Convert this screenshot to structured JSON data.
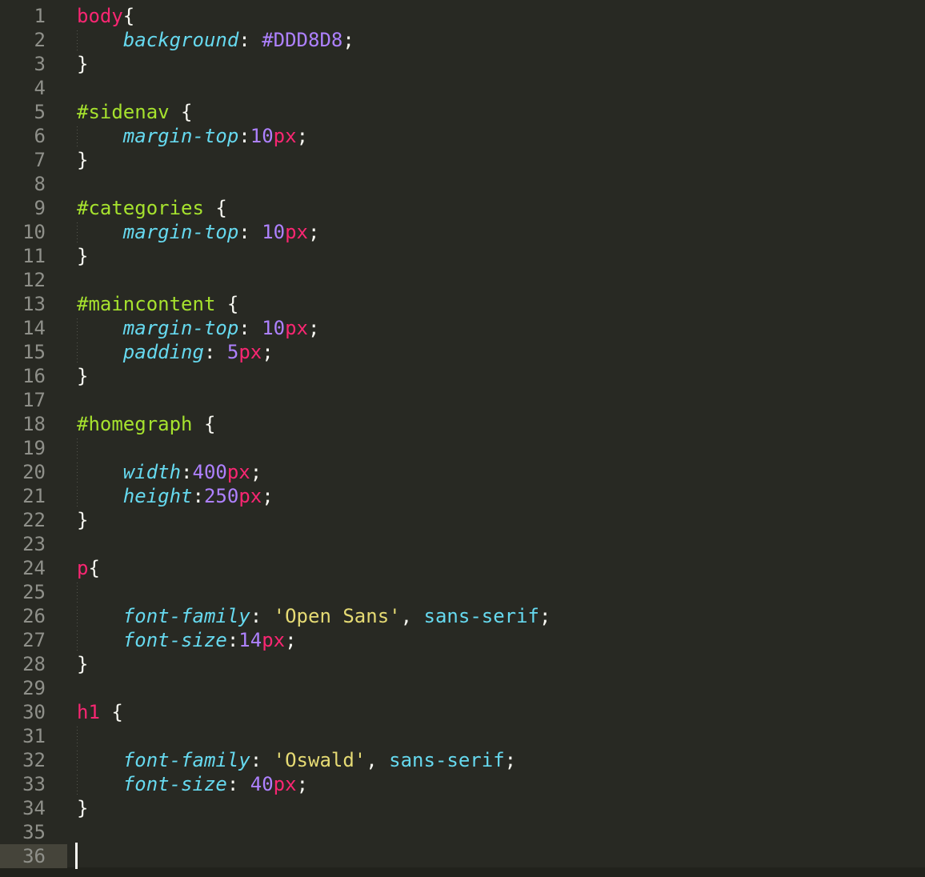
{
  "theme": {
    "bg": "#282923",
    "fg": "#f8f8f2",
    "pink": "#f92672",
    "green": "#a6e22e",
    "cyan": "#66d9ef",
    "purple": "#ae81ff",
    "yellow": "#e6db74",
    "gutter-text": "#8f908a",
    "active-line": "#45443a",
    "guide": "#55564e",
    "caret": "#f8f8f2",
    "bottom": "#21221c"
  },
  "editor": {
    "language": "css",
    "active_line_number": 36,
    "lines": [
      {
        "n": 1,
        "tokens": [
          [
            "sel",
            "body"
          ],
          [
            "punct",
            "{"
          ]
        ]
      },
      {
        "n": 2,
        "guide": true,
        "tokens": [
          [
            "ws",
            "    "
          ],
          [
            "prop",
            "background"
          ],
          [
            "punct",
            ": "
          ],
          [
            "val",
            "#DDD8D8"
          ],
          [
            "punct",
            ";"
          ]
        ]
      },
      {
        "n": 3,
        "tokens": [
          [
            "punct",
            "}"
          ]
        ]
      },
      {
        "n": 4,
        "tokens": []
      },
      {
        "n": 5,
        "tokens": [
          [
            "id",
            "#sidenav"
          ],
          [
            "punct",
            " {"
          ]
        ]
      },
      {
        "n": 6,
        "guide": true,
        "tokens": [
          [
            "ws",
            "    "
          ],
          [
            "prop",
            "margin-top"
          ],
          [
            "punct",
            ":"
          ],
          [
            "val",
            "10"
          ],
          [
            "unit",
            "px"
          ],
          [
            "punct",
            ";"
          ]
        ]
      },
      {
        "n": 7,
        "tokens": [
          [
            "punct",
            "}"
          ]
        ]
      },
      {
        "n": 8,
        "tokens": []
      },
      {
        "n": 9,
        "tokens": [
          [
            "id",
            "#categories"
          ],
          [
            "punct",
            " {"
          ]
        ]
      },
      {
        "n": 10,
        "guide": true,
        "tokens": [
          [
            "ws",
            "    "
          ],
          [
            "prop",
            "margin-top"
          ],
          [
            "punct",
            ": "
          ],
          [
            "val",
            "10"
          ],
          [
            "unit",
            "px"
          ],
          [
            "punct",
            ";"
          ]
        ]
      },
      {
        "n": 11,
        "tokens": [
          [
            "punct",
            "}"
          ]
        ]
      },
      {
        "n": 12,
        "tokens": []
      },
      {
        "n": 13,
        "tokens": [
          [
            "id",
            "#maincontent"
          ],
          [
            "punct",
            " {"
          ]
        ]
      },
      {
        "n": 14,
        "guide": true,
        "tokens": [
          [
            "ws",
            "    "
          ],
          [
            "prop",
            "margin-top"
          ],
          [
            "punct",
            ": "
          ],
          [
            "val",
            "10"
          ],
          [
            "unit",
            "px"
          ],
          [
            "punct",
            ";"
          ]
        ]
      },
      {
        "n": 15,
        "guide": true,
        "tokens": [
          [
            "ws",
            "    "
          ],
          [
            "prop",
            "padding"
          ],
          [
            "punct",
            ": "
          ],
          [
            "val",
            "5"
          ],
          [
            "unit",
            "px"
          ],
          [
            "punct",
            ";"
          ]
        ]
      },
      {
        "n": 16,
        "tokens": [
          [
            "punct",
            "}"
          ]
        ]
      },
      {
        "n": 17,
        "tokens": []
      },
      {
        "n": 18,
        "tokens": [
          [
            "id",
            "#homegraph"
          ],
          [
            "punct",
            " {"
          ]
        ]
      },
      {
        "n": 19,
        "guide": true,
        "tokens": []
      },
      {
        "n": 20,
        "guide": true,
        "tokens": [
          [
            "ws",
            "    "
          ],
          [
            "prop",
            "width"
          ],
          [
            "punct",
            ":"
          ],
          [
            "val",
            "400"
          ],
          [
            "unit",
            "px"
          ],
          [
            "punct",
            ";"
          ]
        ]
      },
      {
        "n": 21,
        "guide": true,
        "tokens": [
          [
            "ws",
            "    "
          ],
          [
            "prop",
            "height"
          ],
          [
            "punct",
            ":"
          ],
          [
            "val",
            "250"
          ],
          [
            "unit",
            "px"
          ],
          [
            "punct",
            ";"
          ]
        ]
      },
      {
        "n": 22,
        "tokens": [
          [
            "punct",
            "}"
          ]
        ]
      },
      {
        "n": 23,
        "tokens": []
      },
      {
        "n": 24,
        "tokens": [
          [
            "sel",
            "p"
          ],
          [
            "punct",
            "{"
          ]
        ]
      },
      {
        "n": 25,
        "guide": true,
        "tokens": []
      },
      {
        "n": 26,
        "guide": true,
        "tokens": [
          [
            "ws",
            "    "
          ],
          [
            "prop",
            "font-family"
          ],
          [
            "punct",
            ": "
          ],
          [
            "str",
            "'Open Sans'"
          ],
          [
            "punct",
            ", "
          ],
          [
            "const",
            "sans-serif"
          ],
          [
            "punct",
            ";"
          ]
        ]
      },
      {
        "n": 27,
        "guide": true,
        "tokens": [
          [
            "ws",
            "    "
          ],
          [
            "prop",
            "font-size"
          ],
          [
            "punct",
            ":"
          ],
          [
            "val",
            "14"
          ],
          [
            "unit",
            "px"
          ],
          [
            "punct",
            ";"
          ]
        ]
      },
      {
        "n": 28,
        "tokens": [
          [
            "punct",
            "}"
          ]
        ]
      },
      {
        "n": 29,
        "tokens": []
      },
      {
        "n": 30,
        "tokens": [
          [
            "sel",
            "h1"
          ],
          [
            "punct",
            " {"
          ]
        ]
      },
      {
        "n": 31,
        "guide": true,
        "tokens": []
      },
      {
        "n": 32,
        "guide": true,
        "tokens": [
          [
            "ws",
            "    "
          ],
          [
            "prop",
            "font-family"
          ],
          [
            "punct",
            ": "
          ],
          [
            "str",
            "'Oswald'"
          ],
          [
            "punct",
            ", "
          ],
          [
            "const",
            "sans-serif"
          ],
          [
            "punct",
            ";"
          ]
        ]
      },
      {
        "n": 33,
        "guide": true,
        "tokens": [
          [
            "ws",
            "    "
          ],
          [
            "prop",
            "font-size"
          ],
          [
            "punct",
            ": "
          ],
          [
            "val",
            "40"
          ],
          [
            "unit",
            "px"
          ],
          [
            "punct",
            ";"
          ]
        ]
      },
      {
        "n": 34,
        "tokens": [
          [
            "punct",
            "}"
          ]
        ]
      },
      {
        "n": 35,
        "tokens": []
      },
      {
        "n": 36,
        "active": true,
        "caret": true,
        "tokens": []
      }
    ]
  }
}
